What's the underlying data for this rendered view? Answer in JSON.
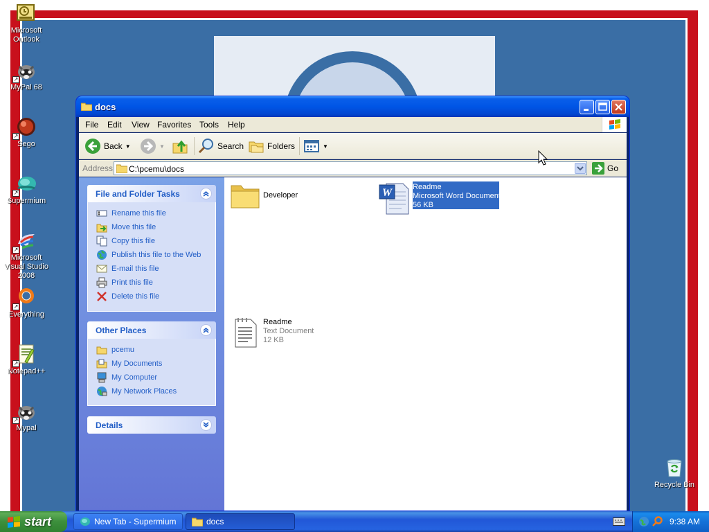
{
  "desktop": {
    "icons": [
      {
        "label": "Microsoft Outlook",
        "icon": "outlook-icon"
      },
      {
        "label": "MyPal 68",
        "icon": "mypal-icon"
      },
      {
        "label": "Sego",
        "icon": "sego-icon"
      },
      {
        "label": "Supermium",
        "icon": "supermium-icon"
      },
      {
        "label": "Microsoft Visual Studio 2008",
        "icon": "visual-studio-icon"
      },
      {
        "label": "Everything",
        "icon": "everything-icon"
      },
      {
        "label": "Notepad++",
        "icon": "notepadpp-icon"
      },
      {
        "label": "Mypal",
        "icon": "mypal-icon"
      },
      {
        "label": "Recycle Bin",
        "icon": "recycle-bin-icon"
      }
    ]
  },
  "window": {
    "title": "docs",
    "menu": [
      "File",
      "Edit",
      "View",
      "Favorites",
      "Tools",
      "Help"
    ],
    "toolbar": {
      "back": "Back",
      "search": "Search",
      "folders": "Folders"
    },
    "address": {
      "label": "Address",
      "path": "C:\\pcemu\\docs",
      "go": "Go"
    }
  },
  "taskpane": {
    "file_tasks": {
      "title": "File and Folder Tasks",
      "items": [
        "Rename this file",
        "Move this file",
        "Copy this file",
        "Publish this file to the Web",
        "E-mail this file",
        "Print this file",
        "Delete this file"
      ]
    },
    "other_places": {
      "title": "Other Places",
      "items": [
        "pcemu",
        "My Documents",
        "My Computer",
        "My Network Places"
      ]
    },
    "details": {
      "title": "Details"
    }
  },
  "files": [
    {
      "name": "Developer",
      "type": "",
      "size": "",
      "icon": "folder-icon",
      "selected": false
    },
    {
      "name": "Readme",
      "type": "Microsoft Word Document",
      "size": "56 KB",
      "icon": "word-document-icon",
      "selected": true
    },
    {
      "name": "Readme",
      "type": "Text Document",
      "size": "12 KB",
      "icon": "text-document-icon",
      "selected": false
    }
  ],
  "taskbar": {
    "start": "start",
    "tasks": [
      {
        "label": "New Tab - Supermium",
        "active": false
      },
      {
        "label": "docs",
        "active": true
      }
    ],
    "clock": "9:38 AM"
  },
  "colors": {
    "titlebar": "#0055e5",
    "taskpane_link": "#215dc6",
    "selection": "#316ac5",
    "desktop_frame": "#c8101c",
    "desktop_background": "#3a6ea5"
  }
}
